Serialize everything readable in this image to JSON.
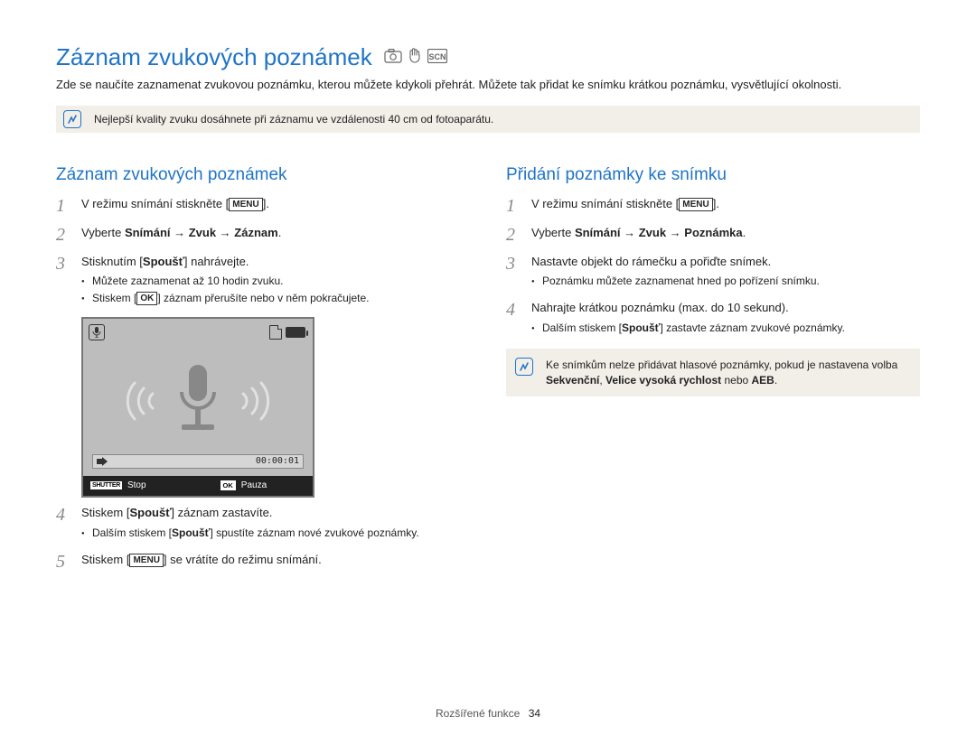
{
  "title": "Záznam zvukových poznámek",
  "intro": "Zde se naučíte zaznamenat zvukovou poznámku, kterou můžete kdykoli přehrát. Můžete tak přidat ke snímku krátkou poznámku, vysvětlující okolnosti.",
  "top_tip": "Nejlepší kvality zvuku dosáhnete při záznamu ve vzdálenosti 40 cm od fotoaparátu.",
  "left": {
    "heading": "Záznam zvukových poznámek",
    "s1_pre": "V režimu snímání stiskněte [",
    "s1_btn": "MENU",
    "s1_post": "].",
    "s2_pre": "Vyberte ",
    "s2_path": "Snímání → Zvuk → Záznam",
    "s2_post": ".",
    "s3_text_pre": "Stisknutím [",
    "s3_bold": "Spoušť",
    "s3_text_post": "] nahrávejte.",
    "s3_b1": "Můžete zaznamenat až 10 hodin zvuku.",
    "s3_b2_pre": "Stiskem [",
    "s3_b2_btn": "OK",
    "s3_b2_post": "] záznam přerušíte nebo v něm pokračujete.",
    "preview": {
      "timer": "00:00:01",
      "shutter_label": "SHUTTER",
      "stop": "Stop",
      "ok_label": "OK",
      "pause": "Pauza"
    },
    "s4_pre": "Stiskem [",
    "s4_bold": "Spoušť",
    "s4_post": "] záznam zastavíte.",
    "s4_b1_pre": "Dalším stiskem [",
    "s4_b1_bold": "Spoušť",
    "s4_b1_post": "] spustíte záznam nové zvukové poznámky.",
    "s5_pre": "Stiskem [",
    "s5_btn": "MENU",
    "s5_post": "] se vrátíte do režimu snímání."
  },
  "right": {
    "heading": "Přidání poznámky ke snímku",
    "s1_pre": "V režimu snímání stiskněte [",
    "s1_btn": "MENU",
    "s1_post": "].",
    "s2_pre": "Vyberte ",
    "s2_path": "Snímání → Zvuk → Poznámka",
    "s2_post": ".",
    "s3_text": "Nastavte objekt do rámečku a pořiďte snímek.",
    "s3_b1": "Poznámku můžete zaznamenat hned po pořízení snímku.",
    "s4_text": "Nahrajte krátkou poznámku (max. do 10 sekund).",
    "s4_b1_pre": "Dalším stiskem [",
    "s4_b1_bold": "Spoušť",
    "s4_b1_post": "] zastavte záznam zvukové poznámky.",
    "tip_pre": "Ke snímkům nelze přidávat hlasové poznámky, pokud je nastavena volba ",
    "tip_b1": "Sekvenční",
    "tip_mid": ", ",
    "tip_b2": "Velice vysoká rychlost",
    "tip_mid2": " nebo ",
    "tip_b3": "AEB",
    "tip_post": "."
  },
  "footer": {
    "section": "Rozšířené funkce",
    "page": "34"
  }
}
